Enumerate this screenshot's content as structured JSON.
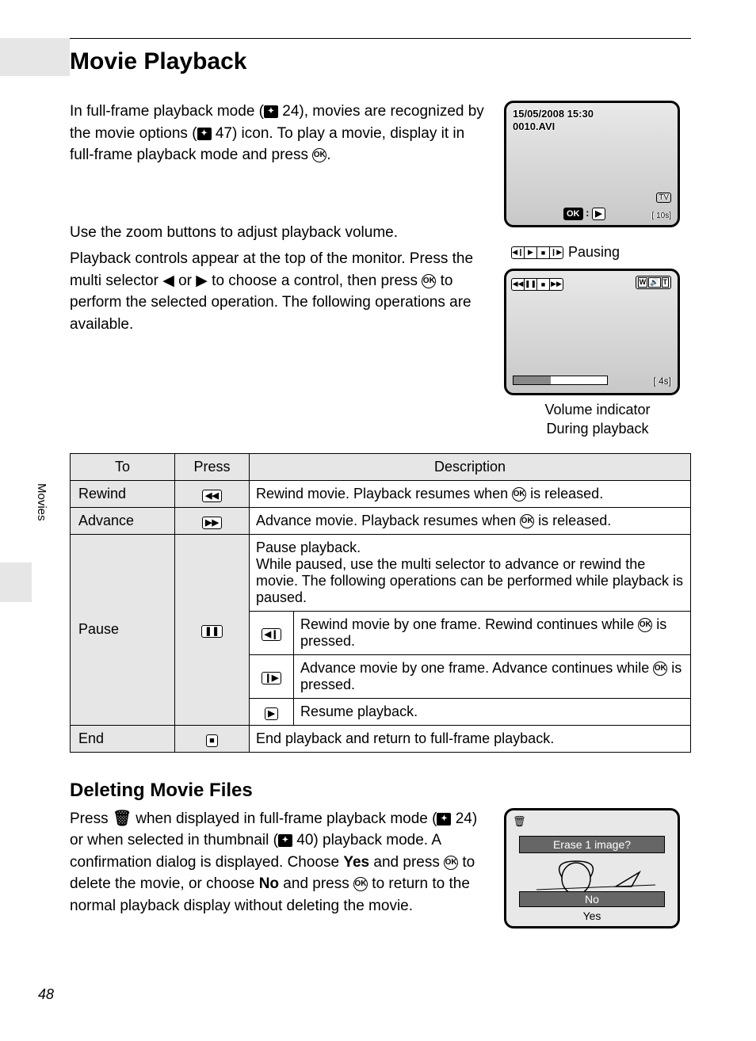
{
  "page_number": "48",
  "side_tab": "Movies",
  "heading": "Movie Playback",
  "intro": {
    "part1": "In full-frame playback mode (",
    "ref1": "24",
    "part2": "), movies are recognized by the movie options (",
    "ref2": "47",
    "part3": ") icon. To play a movie, display it in full-frame playback mode and press ",
    "part4": "."
  },
  "zoom_note": "Use the zoom buttons to adjust playback volume.",
  "controls_desc": {
    "p1": "Playback controls appear at the top of the monitor. Press the multi selector ",
    "p2": " or ",
    "p3": " to choose a control, then press ",
    "p4": " to perform the selected operation. The following operations are available."
  },
  "screen1": {
    "date": "15/05/2008 15:30",
    "file": "0010.AVI",
    "okplay_left": "OK :",
    "br1": "TV",
    "br2": "10s"
  },
  "pausing_label": "Pausing",
  "screen2": {
    "vol": [
      "W",
      "🔊",
      "T"
    ],
    "dur": "4s"
  },
  "captions": {
    "line1": "Volume indicator",
    "line2": "During playback"
  },
  "table": {
    "headers": [
      "To",
      "Press",
      "Description"
    ],
    "rows": [
      {
        "to": "Rewind",
        "icon": "◀◀",
        "desc_pre": "Rewind movie. Playback resumes when ",
        "desc_post": " is released."
      },
      {
        "to": "Advance",
        "icon": "▶▶",
        "desc_pre": "Advance movie. Playback resumes when ",
        "desc_post": " is released."
      },
      {
        "to": "Pause",
        "icon": "❚❚",
        "desc_top": "Pause playback.\nWhile paused, use the multi selector to advance or rewind the movie. The following operations can be performed while playback is paused.",
        "sub": [
          {
            "icon": "◀❙",
            "pre": "Rewind movie by one frame. Rewind continues while ",
            "post": " is pressed."
          },
          {
            "icon": "❙▶",
            "pre": "Advance movie by one frame. Advance continues while ",
            "post": " is pressed."
          },
          {
            "icon": "▶",
            "text": "Resume playback."
          }
        ]
      },
      {
        "to": "End",
        "icon": "■",
        "desc": "End playback and return to full-frame playback."
      }
    ]
  },
  "subsection": "Deleting Movie Files",
  "delete": {
    "p1": "Press ",
    "p2": " when displayed in full-frame playback mode (",
    "ref1": "24",
    "p3": ") or when selected in thumbnail (",
    "ref2": "40",
    "p4": ") playback mode. A confirmation dialog is displayed. Choose ",
    "bold1": "Yes",
    "p5": " and press ",
    "p6": " to delete the movie, or choose ",
    "bold2": "No",
    "p7": " and press ",
    "p8": " to return to the normal playback display without deleting the movie."
  },
  "screen3": {
    "erase": "Erase 1 image?",
    "no": "No",
    "yes": "Yes"
  }
}
